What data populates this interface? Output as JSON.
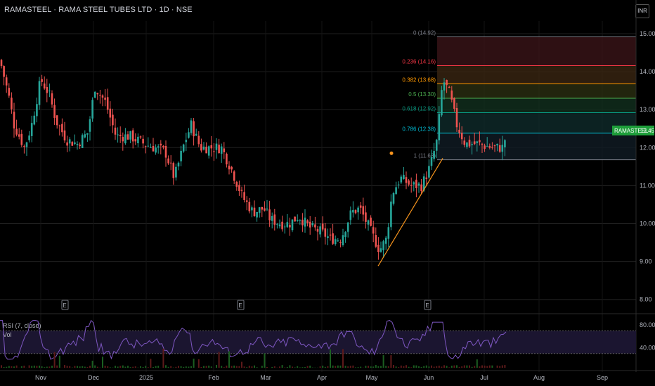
{
  "header": {
    "title": "RAMASTEEL · RAMA STEEL TUBES LTD · 1D · NSE",
    "currency": "INR"
  },
  "colors": {
    "up": "#26a69a",
    "down": "#ef5350",
    "grid": "#1f1f1f",
    "fib": "#2a2e39",
    "rsi": "#7e57c2",
    "trend": "#f7941d",
    "price_tag": "#1e9e3a"
  },
  "chart_data": {
    "type": "candlestick",
    "symbol": "RAMASTEEL",
    "yticks": [
      "8.00",
      "9.00",
      "10.00",
      "11.00",
      "12.00",
      "13.00",
      "14.00",
      "15.00"
    ],
    "xticks": [
      "Nov",
      "Dec",
      "2025",
      "Feb",
      "Mar",
      "Apr",
      "May",
      "Jun",
      "Jul",
      "Aug",
      "Sep"
    ],
    "last_price": "12.45",
    "fib_levels": [
      {
        "ratio": 0,
        "label": "0 (14.92)",
        "value": 14.92,
        "color": "#787b86"
      },
      {
        "ratio": 0.236,
        "label": "0.236 (14.16)",
        "value": 14.16,
        "color": "#f23645"
      },
      {
        "ratio": 0.382,
        "label": "0.382 (13.68)",
        "value": 13.68,
        "color": "#ff9800"
      },
      {
        "ratio": 0.5,
        "label": "0.5 (13.30)",
        "value": 13.3,
        "color": "#4caf50"
      },
      {
        "ratio": 0.618,
        "label": "0.618 (12.92)",
        "value": 12.92,
        "color": "#089981"
      },
      {
        "ratio": 0.786,
        "label": "0.786 (12.38)",
        "value": 12.38,
        "color": "#00bcd4"
      },
      {
        "ratio": 1,
        "label": "1 (11.68)",
        "value": 11.68,
        "color": "#787b86"
      }
    ],
    "earnings_markers": [
      "E",
      "E",
      "E"
    ],
    "rsi": {
      "label": "RSI (7, close)",
      "volume_label": "Vol",
      "yticks": [
        "80.00",
        "40.00"
      ]
    },
    "trend_line": {
      "from": [
        "May",
        8.9
      ],
      "to": [
        "Jun",
        11.7
      ]
    }
  }
}
